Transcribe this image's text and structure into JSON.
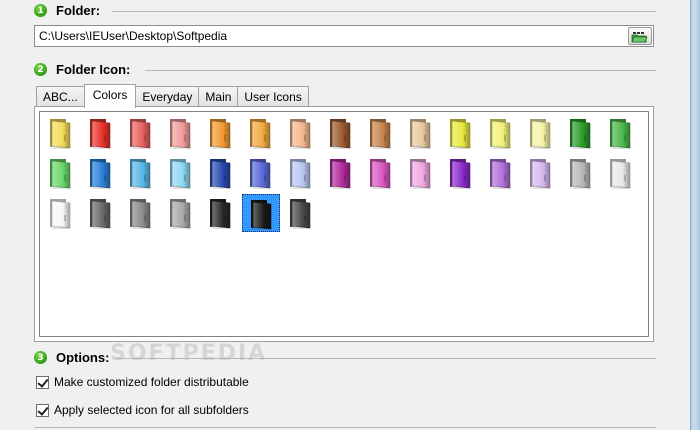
{
  "folder_section": {
    "step": "1",
    "title": "Folder:",
    "path_value": "C:\\Users\\IEUser\\Desktop\\Softpedia"
  },
  "icon_section": {
    "step": "2",
    "title": "Folder Icon:",
    "tabs": [
      {
        "label": "ABC..."
      },
      {
        "label": "Colors"
      },
      {
        "label": "Everyday"
      },
      {
        "label": "Main"
      },
      {
        "label": "User Icons"
      }
    ],
    "active_tab": "Colors",
    "folders": [
      "#f2dc5a",
      "#e8322a",
      "#e86060",
      "#f29c9c",
      "#f29a30",
      "#f2aa40",
      "#f5b890",
      "#9c5a30",
      "#c8864e",
      "#e8c8a0",
      "#e8e840",
      "#f2f07a",
      "#f4f4a8",
      "#2a9c2a",
      "#4ab84a",
      "#6ad86a",
      "#2a80d8",
      "#5ab8e8",
      "#90d8f2",
      "#2a4ab0",
      "#5a6ad8",
      "#b8c8f2",
      "#b02a9c",
      "#d858c0",
      "#f0a8e0",
      "#8a2ac8",
      "#b070d8",
      "#d8b8f0",
      "#b8b8b8",
      "#e8e8e8",
      "#f8f8f8",
      "#6a6a6a",
      "#8a8a8a",
      "#a8a8a8",
      "#2a2a2a",
      "#1a1a1a",
      "#484848"
    ],
    "selected_index": 35
  },
  "options_section": {
    "step": "3",
    "title": "Options:",
    "checkboxes": [
      {
        "label": "Make customized folder distributable",
        "checked": true
      },
      {
        "label": "Apply selected icon for all subfolders",
        "checked": true
      }
    ]
  },
  "watermark": "SOFTPEDIA"
}
